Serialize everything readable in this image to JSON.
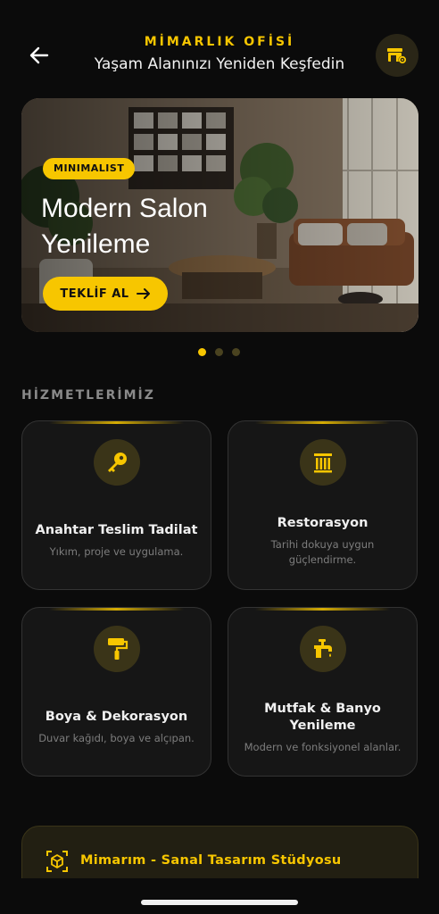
{
  "header": {
    "brand": "MİMARLIK OFİSİ",
    "subtitle": "Yaşam Alanınızı Yeniden Keşfedin"
  },
  "hero": {
    "badge": "MINIMALIST",
    "title": "Modern Salon Yenileme",
    "cta_label": "TEKLİF AL"
  },
  "carousel": {
    "count": 3,
    "active_index": 0
  },
  "services": {
    "title": "HİZMETLERİMİZ",
    "items": [
      {
        "icon": "key-icon",
        "title": "Anahtar Teslim Tadilat",
        "desc": "Yıkım, proje ve uygulama."
      },
      {
        "icon": "column-icon",
        "title": "Restorasyon",
        "desc": "Tarihi dokuya uygun güçlendirme."
      },
      {
        "icon": "paint-roller-icon",
        "title": "Boya & Dekorasyon",
        "desc": "Duvar kağıdı, boya ve alçıpan."
      },
      {
        "icon": "faucet-icon",
        "title": "Mutfak & Banyo Yenileme",
        "desc": "Modern ve fonksiyonel alanlar."
      }
    ]
  },
  "studio": {
    "label": "Mimarım - Sanal Tasarım Stüdyosu",
    "icon": "cube-icon"
  },
  "colors": {
    "accent": "#f7c600",
    "background": "#0b0b0b",
    "card": "#161616"
  }
}
